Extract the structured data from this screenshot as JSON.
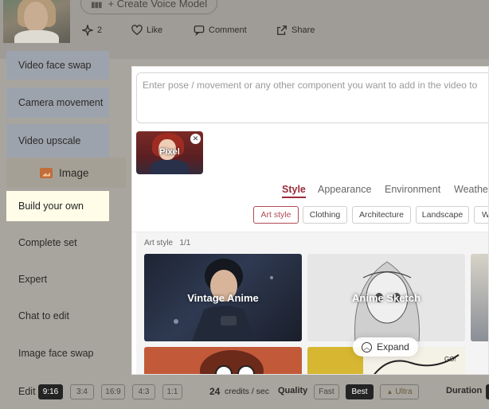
{
  "header": {
    "create_voice_label": "+ Create Voice Model",
    "stats": {
      "stars": "2",
      "like": "Like",
      "comment": "Comment",
      "share": "Share"
    }
  },
  "sidebar": {
    "items_top": [
      "Video face swap",
      "Camera movement",
      "Video upscale"
    ],
    "section_label": "Image",
    "items_bottom": [
      "Build your own",
      "Complete set",
      "Expert",
      "Chat to edit",
      "Image face swap"
    ],
    "active_item": "Build your own"
  },
  "bottom": {
    "edit_label": "Edit",
    "ratios": [
      "9:16",
      "3:4",
      "16:9",
      "4:3",
      "1:1"
    ],
    "selected_ratio": "9:16",
    "credits_value": "24",
    "credits_unit": "credits / sec",
    "quality_label": "Quality",
    "quality_options": [
      "Fast",
      "Best",
      "Ultra"
    ],
    "selected_quality": "Best",
    "duration_label": "Duration"
  },
  "panel": {
    "prompt_placeholder": "Enter pose / movement or any other component you want to add in the video to",
    "selected_chip": "Pixel",
    "tabs": [
      "Style",
      "Appearance",
      "Environment",
      "Weathe"
    ],
    "active_tab": "Style",
    "subtabs": [
      "Art style",
      "Clothing",
      "Architecture",
      "Landscape",
      "W"
    ],
    "active_subtab": "Art style",
    "gallery_title": "Art style",
    "gallery_count": "1/1",
    "cards": [
      "Vintage Anime",
      "Anime Sketch"
    ],
    "expand_label": "Expand"
  },
  "colors": {
    "accent": "#9b2c3a",
    "active_item_bg": "#fffde8"
  }
}
